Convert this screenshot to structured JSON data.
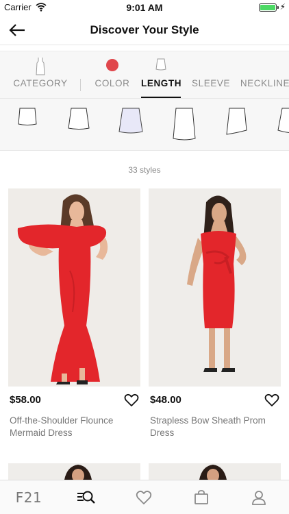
{
  "status_bar": {
    "carrier": "Carrier",
    "time": "9:01 AM"
  },
  "nav": {
    "title": "Discover Your Style"
  },
  "filter_tabs": [
    {
      "label": "CATEGORY",
      "active": false
    },
    {
      "label": "COLOR",
      "active": false
    },
    {
      "label": "LENGTH",
      "active": true
    },
    {
      "label": "SLEEVE",
      "active": false
    },
    {
      "label": "NECKLINE",
      "active": false
    }
  ],
  "colors": {
    "selected_color_swatch": "#e0474c",
    "dress_red": "#e3262b",
    "selected_option_tint": "#e8e8f8"
  },
  "result_count": "33 styles",
  "products": [
    {
      "price": "$58.00",
      "name": "Off-the-Shoulder Flounce Mermaid Dress"
    },
    {
      "price": "$48.00",
      "name": "Strapless Bow Sheath Prom Dress"
    }
  ],
  "tab_bar": [
    {
      "label": "F21",
      "icon": "f21-logo"
    },
    {
      "icon": "discover-search-icon"
    },
    {
      "icon": "heart-icon"
    },
    {
      "icon": "shopping-bag-icon"
    },
    {
      "icon": "profile-icon"
    }
  ]
}
